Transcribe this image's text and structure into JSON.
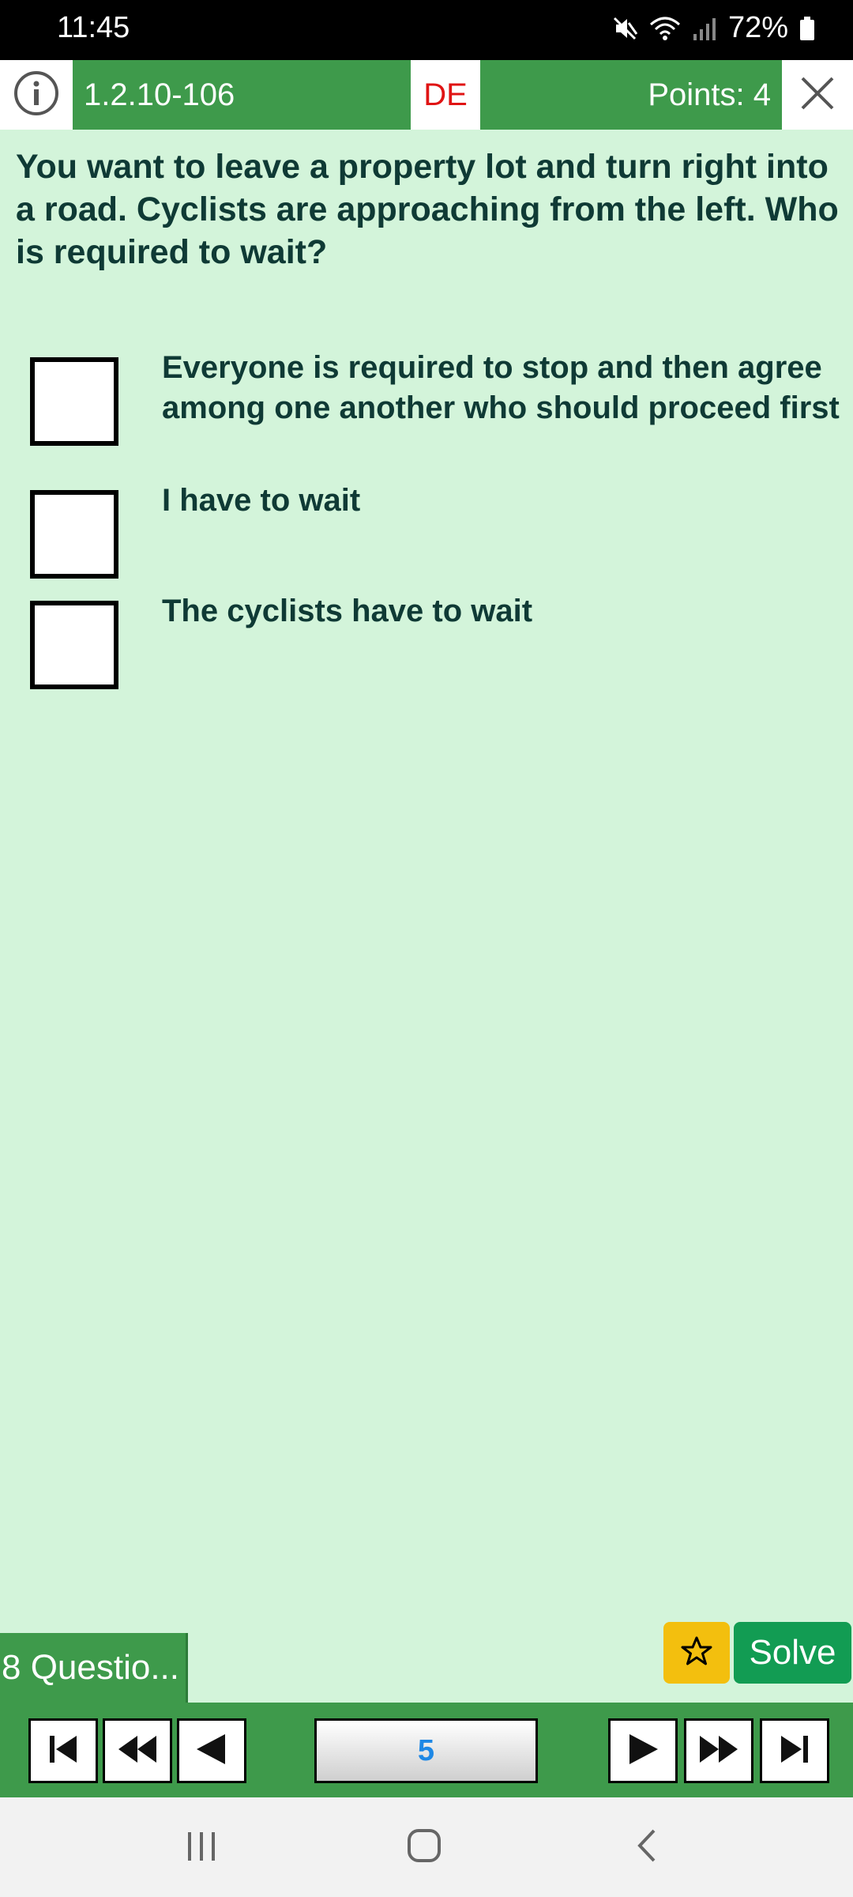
{
  "status_bar": {
    "time": "11:45",
    "battery": "72%"
  },
  "header": {
    "question_code": "1.2.10-106",
    "language": "DE",
    "points": "Points: 4"
  },
  "question": {
    "text": "You want to leave a property lot and turn right into a road. Cyclists are approaching from the left. Who is required to wait?"
  },
  "answers": [
    {
      "text": "Everyone is required to stop and then agree among one another who should proceed first",
      "checked": false
    },
    {
      "text": "I have to wait",
      "checked": false
    },
    {
      "text": "The cyclists have to wait",
      "checked": false
    }
  ],
  "bottom": {
    "questions_tab": "8 Questio...",
    "solve_label": "Solve"
  },
  "navigation": {
    "current_page": "5"
  },
  "colors": {
    "header_green": "#3e9a4b",
    "background": "#d3f4da",
    "language_red": "#e01414",
    "star_yellow": "#f3bf0e",
    "solve_green": "#129c53",
    "page_number_blue": "#1e88e5"
  }
}
